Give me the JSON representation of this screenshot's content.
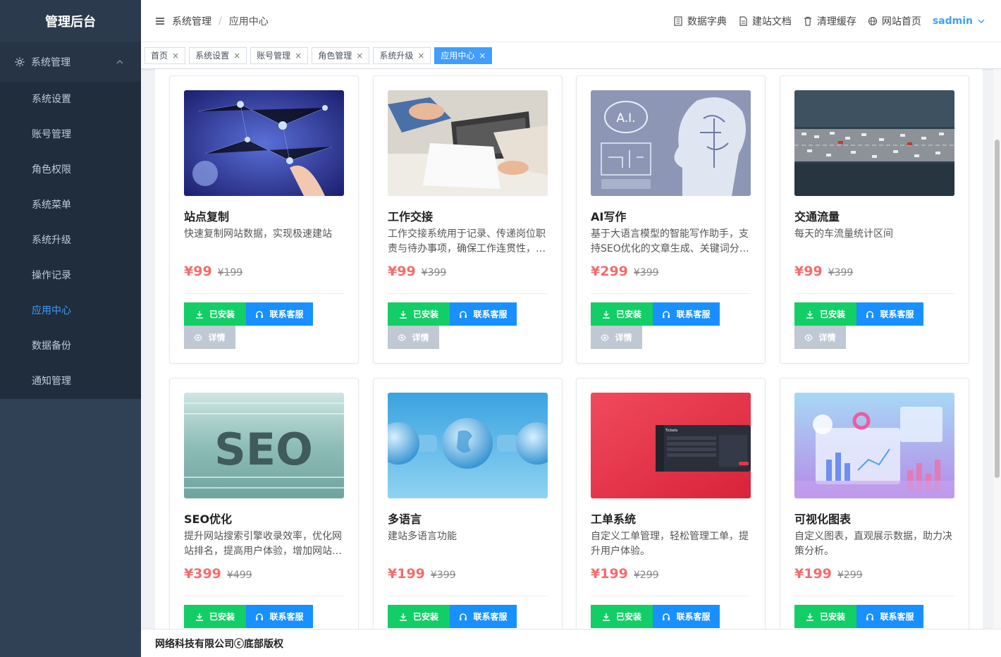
{
  "sidebar": {
    "brand": "管理后台",
    "parent": {
      "label": "系统管理",
      "icon": "gear-icon"
    },
    "items": [
      {
        "label": "系统设置"
      },
      {
        "label": "账号管理"
      },
      {
        "label": "角色权限"
      },
      {
        "label": "系统菜单"
      },
      {
        "label": "系统升级"
      },
      {
        "label": "操作记录"
      },
      {
        "label": "应用中心"
      },
      {
        "label": "数据备份"
      },
      {
        "label": "通知管理"
      }
    ],
    "active_item": "应用中心"
  },
  "header": {
    "breadcrumb": [
      "系统管理",
      "应用中心"
    ],
    "links": [
      {
        "label": "数据字典",
        "icon": "dictionary-icon"
      },
      {
        "label": "建站文档",
        "icon": "document-icon"
      },
      {
        "label": "清理缓存",
        "icon": "trash-icon"
      },
      {
        "label": "网站首页",
        "icon": "globe-icon"
      }
    ],
    "user": "sadmin"
  },
  "tags": [
    {
      "label": "首页",
      "active": false
    },
    {
      "label": "系统设置",
      "active": false
    },
    {
      "label": "账号管理",
      "active": false
    },
    {
      "label": "角色管理",
      "active": false
    },
    {
      "label": "系统升级",
      "active": false
    },
    {
      "label": "应用中心",
      "active": true
    }
  ],
  "buttons": {
    "installed": "已安装",
    "contact": "联系客服",
    "detail": "详情"
  },
  "apps": [
    {
      "title": "站点复制",
      "desc": "快速复制网站数据，实现极速建站",
      "price": "¥99",
      "old_price": "¥199"
    },
    {
      "title": "工作交接",
      "desc": "工作交接系统用于记录、传递岗位职责与待办事项，确保工作连贯性，…",
      "price": "¥99",
      "old_price": "¥399"
    },
    {
      "title": "AI写作",
      "desc": "基于大语言模型的智能写作助手，支持SEO优化的文章生成、关键词分…",
      "price": "¥299",
      "old_price": "¥399"
    },
    {
      "title": "交通流量",
      "desc": "每天的车流量统计区间",
      "price": "¥99",
      "old_price": "¥399"
    },
    {
      "title": "SEO优化",
      "desc": "提升网站搜索引擎收录效率，优化网站排名，提高用户体验，增加网站…",
      "price": "¥399",
      "old_price": "¥499"
    },
    {
      "title": "多语言",
      "desc": "建站多语言功能",
      "price": "¥199",
      "old_price": "¥399"
    },
    {
      "title": "工单系统",
      "desc": "自定义工单管理，轻松管理工单，提升用户体验。",
      "price": "¥199",
      "old_price": "¥299"
    },
    {
      "title": "可视化图表",
      "desc": "自定义图表，直观展示数据，助力决策分析。",
      "price": "¥199",
      "old_price": "¥299"
    }
  ],
  "image_texts": {
    "ai": "A.I.",
    "seo": "SEO",
    "ticket": "Tickets"
  },
  "footer": "网络科技有限公司ⓒ底部版权",
  "colors": {
    "sidebar_bg": "#304156",
    "accent": "#409eff",
    "installed": "#13ce66",
    "contact": "#1890ff",
    "price": "#f56c6c"
  }
}
